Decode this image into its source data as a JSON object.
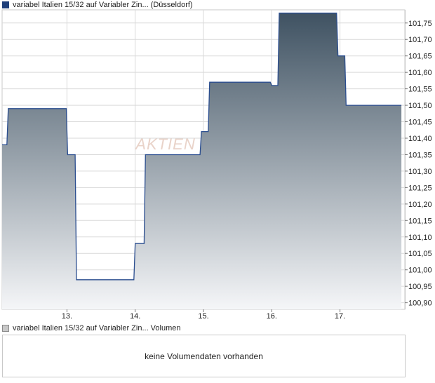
{
  "price_panel": {
    "legend_label": "variabel Italien 15/32 auf Variabler Zin... (Düsseldorf)",
    "watermark": "AKTIEN"
  },
  "volume_panel": {
    "legend_label": "variabel Italien 15/32 auf Variabler Zin... Volumen",
    "empty_message": "keine Volumendaten vorhanden"
  },
  "colors": {
    "line": "#2a4d8f",
    "fill_top": "#3f5262",
    "fill_bottom": "#f5f6f8",
    "grid": "#d9d9d9",
    "frame": "#c8c8c8"
  },
  "chart_data": {
    "type": "area",
    "x_tick_labels": [
      "13.",
      "14.",
      "15.",
      "16.",
      "17."
    ],
    "x_ticks": [
      13,
      14,
      15,
      16,
      17
    ],
    "xlim": [
      12.05,
      17.95
    ],
    "ylim": [
      100.88,
      101.79
    ],
    "y_ticks": [
      100.9,
      100.95,
      101.0,
      101.05,
      101.1,
      101.15,
      101.2,
      101.25,
      101.3,
      101.35,
      101.4,
      101.45,
      101.5,
      101.55,
      101.6,
      101.65,
      101.7,
      101.75
    ],
    "y_tick_labels": [
      "100,90",
      "100,95",
      "101,00",
      "101,05",
      "101,10",
      "101,15",
      "101,20",
      "101,25",
      "101,30",
      "101,35",
      "101,40",
      "101,45",
      "101,50",
      "101,55",
      "101,60",
      "101,65",
      "101,70",
      "101,75"
    ],
    "series": [
      {
        "x": [
          12.05,
          12.12,
          12.14,
          12.99,
          13.01,
          13.12,
          13.14,
          13.98,
          14.0,
          14.13,
          14.15,
          14.95,
          14.97,
          15.07,
          15.09,
          15.98,
          16.0,
          16.09,
          16.11,
          16.95,
          16.97,
          17.07,
          17.09,
          17.9
        ],
        "y": [
          101.38,
          101.38,
          101.49,
          101.49,
          101.35,
          101.35,
          100.97,
          100.97,
          101.08,
          101.08,
          101.35,
          101.35,
          101.42,
          101.42,
          101.57,
          101.57,
          101.56,
          101.56,
          101.78,
          101.78,
          101.65,
          101.65,
          101.5,
          101.5
        ]
      }
    ]
  }
}
